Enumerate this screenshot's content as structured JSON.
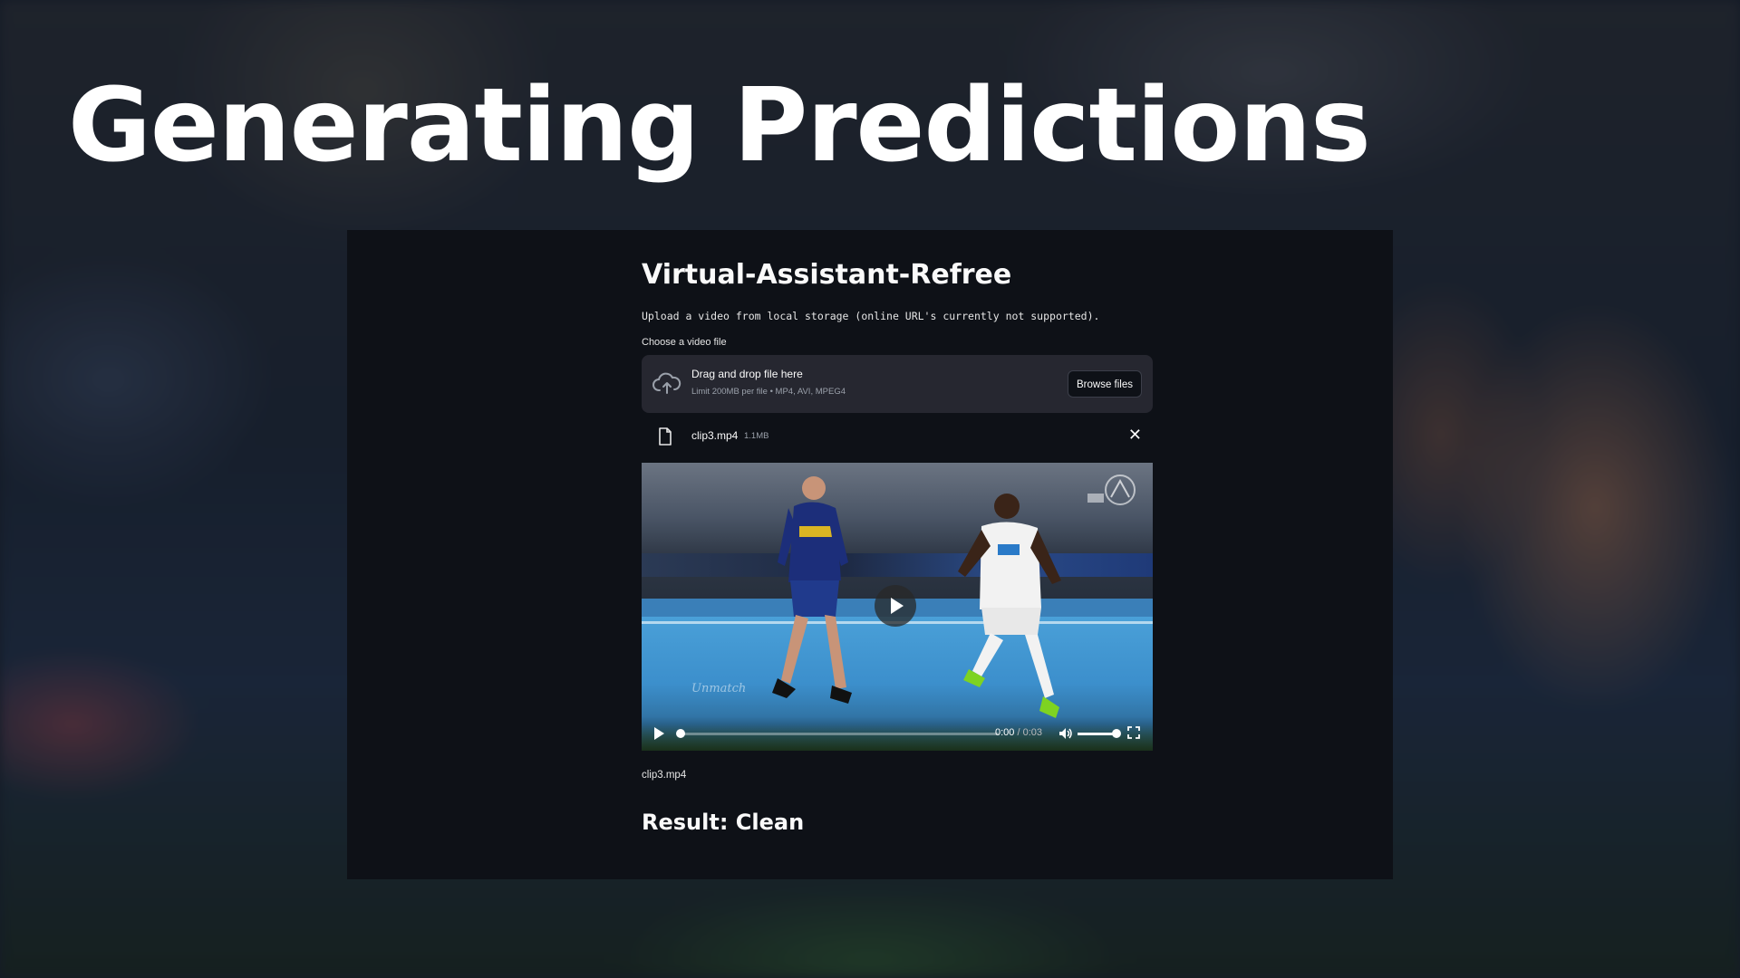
{
  "slide": {
    "title": "Generating Predictions"
  },
  "app": {
    "title": "Virtual-Assistant-Refree",
    "description": "Upload a video from local storage (online URL's currently not supported).",
    "uploader": {
      "label": "Choose a video file",
      "drop_text": "Drag and drop file here",
      "limit_text": "Limit 200MB per file • MP4, AVI, MPEG4",
      "browse_label": "Browse files",
      "icon": "cloud-upload-icon"
    },
    "uploaded_file": {
      "name": "clip3.mp4",
      "size": "1.1MB",
      "icon": "file-icon",
      "remove_label": "✕"
    },
    "video": {
      "current_time": "0:00",
      "separator": " / ",
      "duration": "0:03",
      "watermark": "Unmatch",
      "progress": 0,
      "volume": 1.0
    },
    "caption": "clip3.mp4",
    "result": "Result: Clean"
  },
  "colors": {
    "app_bg": "#0e1117",
    "dropzone_bg": "#262730",
    "text": "#fafafa"
  }
}
